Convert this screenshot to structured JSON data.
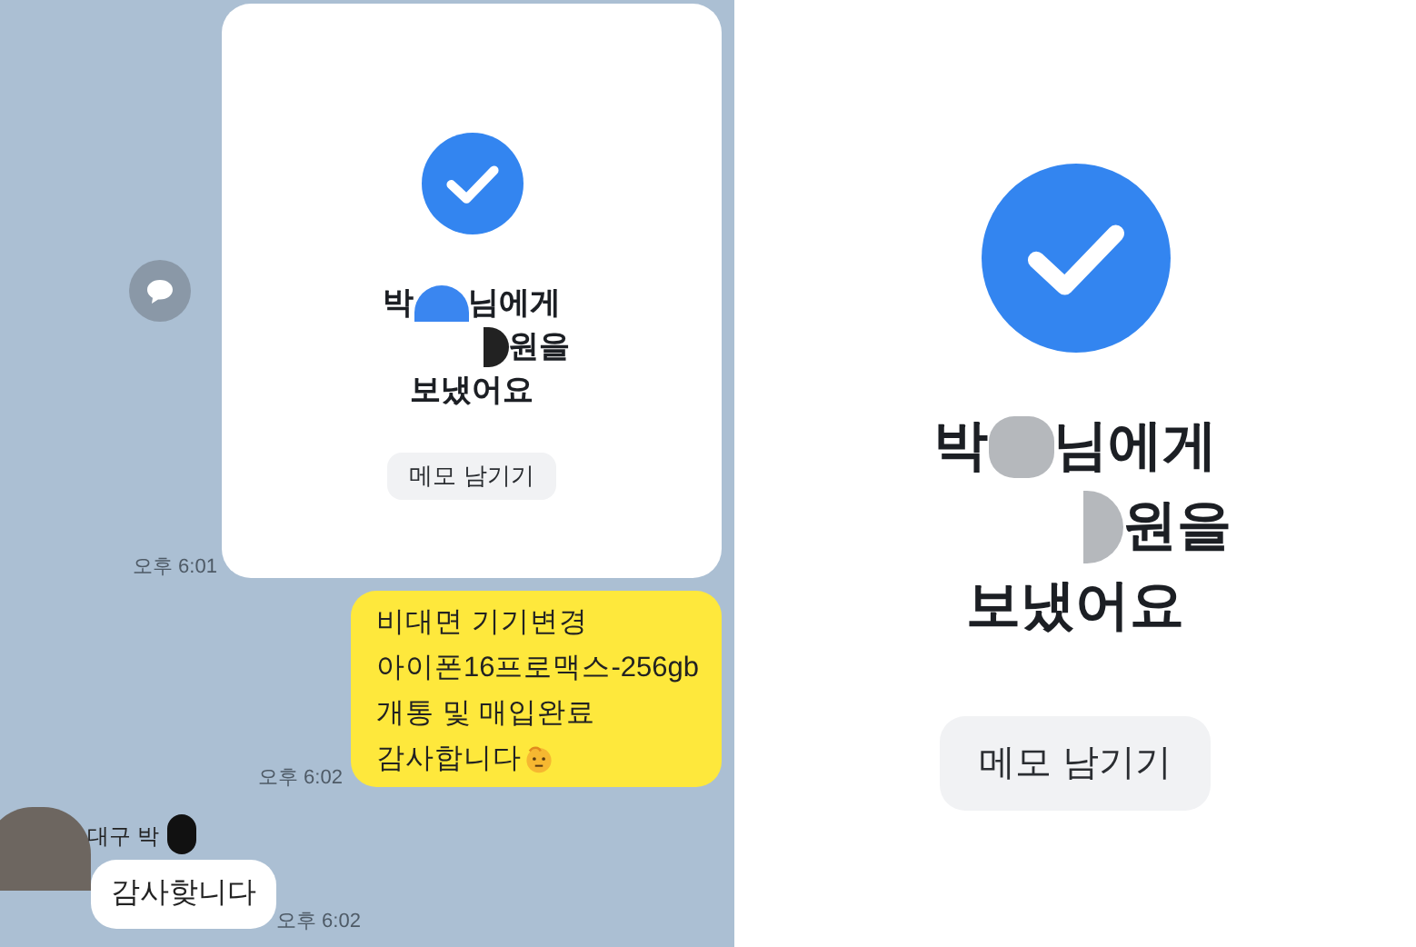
{
  "chat": {
    "messages": [
      {
        "kind": "transfer_card",
        "name_start": "박",
        "name_end": "님에게",
        "amount_end": "원을",
        "sent": "보냈어요",
        "memo_button": "메모 남기기",
        "time": "오후 6:01"
      },
      {
        "kind": "outgoing",
        "lines": [
          "비대면 기기변경",
          "아이폰16프로맥스-256gb",
          "개통 및 매입완료",
          "감사합니다"
        ],
        "time": "오후 6:02"
      },
      {
        "kind": "incoming",
        "sender": "대구 박",
        "text": "감사핮니다",
        "time": "오후 6:02"
      }
    ]
  },
  "detail": {
    "name_start": "박",
    "name_end": "님에게",
    "amount_end": "원을",
    "sent": "보냈어요",
    "memo_button": "메모 남기기"
  }
}
